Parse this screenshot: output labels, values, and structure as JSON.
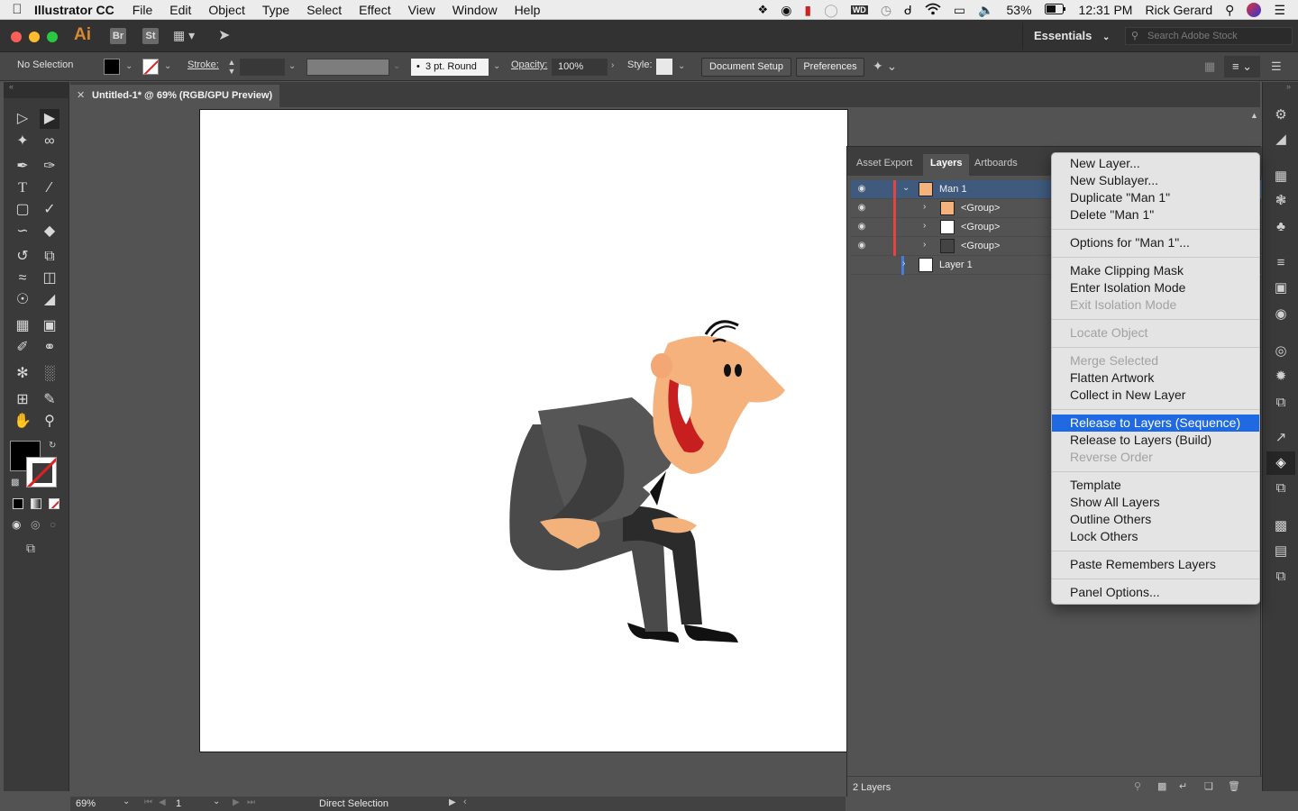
{
  "menubar": {
    "app_name": "Illustrator CC",
    "menus": [
      "File",
      "Edit",
      "Object",
      "Type",
      "Select",
      "Effect",
      "View",
      "Window",
      "Help"
    ],
    "battery": "53%",
    "time": "12:31 PM",
    "user": "Rick Gerard"
  },
  "appbar": {
    "logo": "Ai",
    "bridge": "Br",
    "stock_btn": "St",
    "workspace": "Essentials",
    "search_placeholder": "Search Adobe Stock"
  },
  "control": {
    "selection": "No Selection",
    "stroke_label": "Stroke:",
    "brush": "3 pt. Round",
    "opacity_label": "Opacity:",
    "opacity": "100%",
    "style_label": "Style:",
    "doc_setup": "Document Setup",
    "preferences": "Preferences"
  },
  "document": {
    "tab": "Untitled-1* @ 69% (RGB/GPU Preview)"
  },
  "status": {
    "zoom": "69%",
    "artboard": "1",
    "tool": "Direct Selection"
  },
  "panel": {
    "tabs": [
      "Asset Export",
      "Layers",
      "Artboards"
    ],
    "rows": [
      {
        "name": "Man 1",
        "color": "#e04545"
      },
      {
        "name": "<Group>",
        "color": "#e04545"
      },
      {
        "name": "<Group>",
        "color": "#e04545"
      },
      {
        "name": "<Group>",
        "color": "#e04545"
      },
      {
        "name": "Layer 1",
        "color": "#4a7bd6"
      }
    ],
    "footer": "2 Layers"
  },
  "menu": {
    "items": [
      {
        "label": "New Layer...",
        "state": "enabled"
      },
      {
        "label": "New Sublayer...",
        "state": "enabled"
      },
      {
        "label": "Duplicate \"Man 1\"",
        "state": "enabled"
      },
      {
        "label": "Delete \"Man 1\"",
        "state": "enabled"
      },
      {
        "label": "Options for \"Man 1\"...",
        "state": "enabled"
      },
      {
        "label": "Make Clipping Mask",
        "state": "enabled"
      },
      {
        "label": "Enter Isolation Mode",
        "state": "enabled"
      },
      {
        "label": "Exit Isolation Mode",
        "state": "disabled"
      },
      {
        "label": "Locate Object",
        "state": "disabled"
      },
      {
        "label": "Merge Selected",
        "state": "disabled"
      },
      {
        "label": "Flatten Artwork",
        "state": "enabled"
      },
      {
        "label": "Collect in New Layer",
        "state": "enabled"
      },
      {
        "label": "Release to Layers (Sequence)",
        "state": "highlighted"
      },
      {
        "label": "Release to Layers (Build)",
        "state": "enabled"
      },
      {
        "label": "Reverse Order",
        "state": "disabled"
      },
      {
        "label": "Template",
        "state": "enabled"
      },
      {
        "label": "Show All Layers",
        "state": "enabled"
      },
      {
        "label": "Outline Others",
        "state": "enabled"
      },
      {
        "label": "Lock Others",
        "state": "enabled"
      },
      {
        "label": "Paste Remembers Layers",
        "state": "enabled"
      },
      {
        "label": "Panel Options...",
        "state": "enabled"
      }
    ]
  },
  "colors": {
    "accent_highlight": "#1f69e2",
    "ai_logo": "#d68a31",
    "selected_row": "#3f5a7d"
  }
}
